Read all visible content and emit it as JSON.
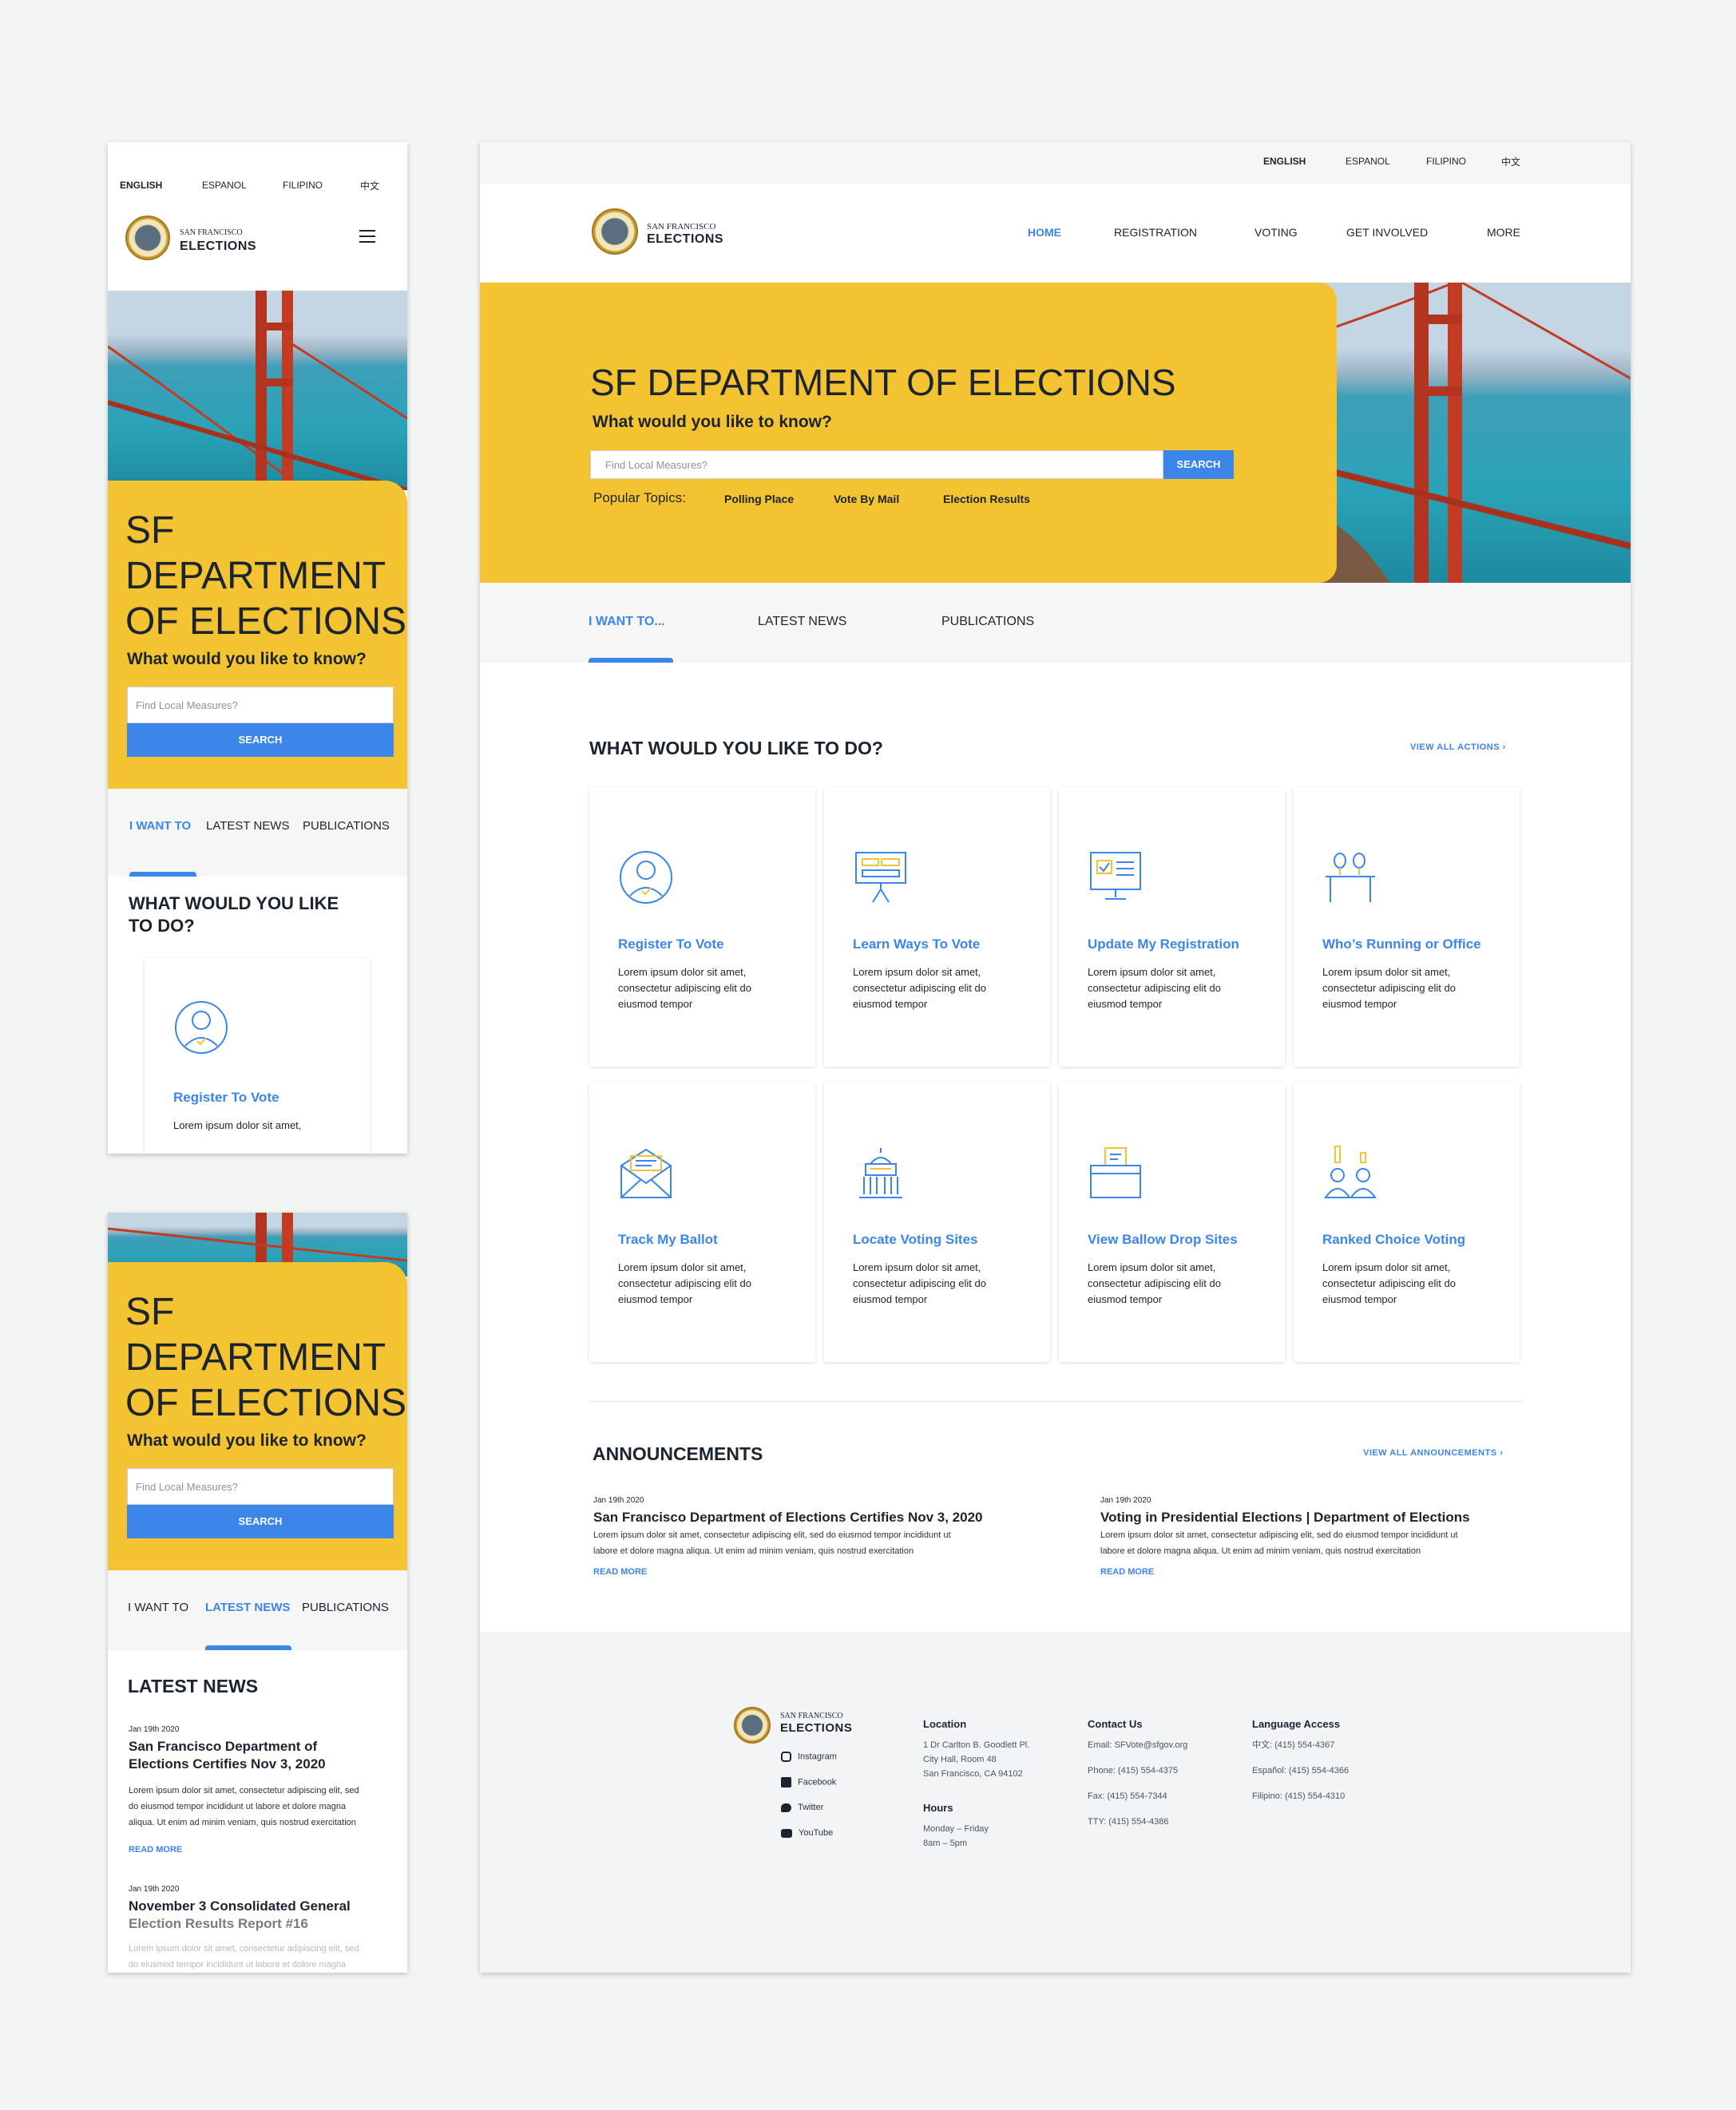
{
  "languages": [
    "ENGLISH",
    "ESPANOL",
    "FILIPINO",
    "中文"
  ],
  "logo": {
    "line1": "SAN FRANCISCO",
    "line2": "ELECTIONS"
  },
  "nav": [
    "HOME",
    "REGISTRATION",
    "VOTING",
    "GET INVOLVED",
    "MORE"
  ],
  "hero": {
    "title": "SF DEPARTMENT OF ELECTIONS",
    "mobile_title_lines": [
      "SF",
      "DEPARTMENT",
      "OF ELECTIONS"
    ],
    "subtitle": "What would you like to know?",
    "placeholder": "Find Local Measures?",
    "search_label": "SEARCH",
    "popular_label": "Popular Topics:",
    "topics": [
      "Polling Place",
      "Vote By Mail",
      "Election Results"
    ]
  },
  "tabs": {
    "desktop": [
      "I WANT TO...",
      "LATEST NEWS",
      "PUBLICATIONS"
    ],
    "mobile": [
      "I WANT TO",
      "LATEST NEWS",
      "PUBLICATIONS"
    ]
  },
  "actions": {
    "heading": "WHAT WOULD YOU LIKE TO DO?",
    "mobile_heading_lines": [
      "WHAT WOULD YOU LIKE",
      "TO DO?"
    ],
    "view_all": "VIEW ALL ACTIONS",
    "desc_lines": [
      "Lorem ipsum dolor sit amet,",
      "consectetur adipiscing elit do",
      "eiusmod tempor"
    ],
    "items": [
      {
        "title": "Register To Vote",
        "icon": "person-check-icon"
      },
      {
        "title": "Learn Ways To Vote",
        "icon": "presentation-board-icon"
      },
      {
        "title": "Update My Registration",
        "icon": "monitor-form-icon"
      },
      {
        "title": "Who’s Running or Office",
        "icon": "podium-icon"
      },
      {
        "title": "Track My Ballot",
        "icon": "envelope-icon"
      },
      {
        "title": "Locate Voting Sites",
        "icon": "capitol-building-icon"
      },
      {
        "title": "View Ballow Drop Sites",
        "icon": "drop-box-icon"
      },
      {
        "title": "Ranked Choice Voting",
        "icon": "candidates-icon"
      }
    ],
    "mobile_desc": "Lorem ipsum dolor sit amet,"
  },
  "announcements": {
    "heading": "ANNOUNCEMENTS",
    "view_all": "VIEW ALL ANNOUNCEMENTS",
    "read_more": "READ MORE",
    "body_lines": [
      "Lorem ipsum dolor sit amet, consectetur adipiscing elit, sed do eiusmod tempor incididunt ut",
      "labore et dolore magna aliqua. Ut enim ad minim veniam, quis nostrud exercitation"
    ],
    "items": [
      {
        "date": "Jan 19th 2020",
        "title": "San Francisco Department of Elections Certifies Nov 3, 2020"
      },
      {
        "date": "Jan 19th 2020",
        "title": "Voting in Presidential Elections | Department of Elections"
      }
    ]
  },
  "latest_news": {
    "heading": "LATEST NEWS",
    "body_lines": [
      "Lorem ipsum dolor sit amet, consectetur adipiscing elit, sed",
      "do eiusmod tempor incididunt ut labore et dolore magna",
      "aliqua. Ut enim ad minim veniam, quis nostrud exercitation"
    ],
    "partial_body_lines": [
      "Lorem ipsum dolor sit amet, consectetur adipiscing elit, sed",
      "do eiusmod tempor incididunt ut labore et dolore magna"
    ],
    "items": [
      {
        "date": "Jan 19th 2020",
        "title_lines": [
          "San Francisco Department of",
          "Elections Certifies Nov 3, 2020"
        ]
      },
      {
        "date": "Jan 19th 2020",
        "title_lines": [
          "November 3 Consolidated General",
          "Election Results Report #16"
        ]
      }
    ],
    "read_more": "READ MORE"
  },
  "footer": {
    "social": [
      "Instagram",
      "Facebook",
      "Twitter",
      "YouTube"
    ],
    "location": {
      "heading": "Location",
      "lines": [
        "1 Dr Carlton B. Goodlett Pl.",
        "City Hall, Room 48",
        "San Francisco, CA 94102"
      ]
    },
    "hours": {
      "heading": "Hours",
      "lines": [
        "Monday – Friday",
        "8am – 5pm"
      ]
    },
    "contact": {
      "heading": "Contact Us",
      "lines": [
        "Email: SFVote@sfgov.org",
        "Phone: (415) 554-4375",
        "Fax: (415) 554-7344",
        "TTY: (415) 554-4386"
      ]
    },
    "language": {
      "heading": "Language Access",
      "lines": [
        "中文: (415) 554-4367",
        "Español: (415) 554-4366",
        "Filipino: (415) 554-4310"
      ]
    }
  },
  "colors": {
    "accent": "#3b86e8",
    "yellow": "#f4c331",
    "navy": "#1c2430",
    "bridge": "#c23b22"
  }
}
